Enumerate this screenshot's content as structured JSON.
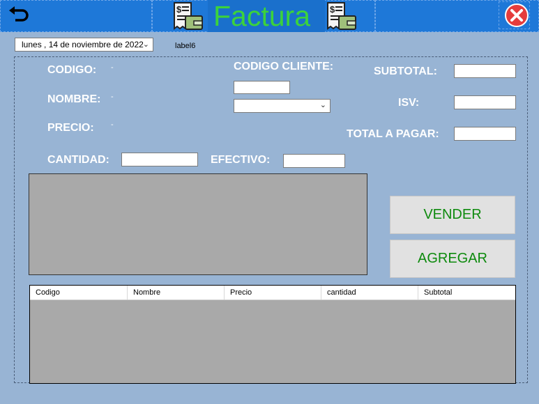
{
  "titlebar": {
    "title": "Factura",
    "back_icon": "back-arrow-icon",
    "close_icon": "close-icon",
    "invoice_icon": "invoice-icon"
  },
  "date_picker": {
    "value": "lunes    , 14 de noviembre de 2022"
  },
  "small_label": "label6",
  "form": {
    "codigo_label": "CODIGO:",
    "codigo_value": "-",
    "nombre_label": "NOMBRE:",
    "nombre_value": "-",
    "precio_label": "PRECIO:",
    "precio_value": "-",
    "codigo_cliente_label": "CODIGO CLIENTE:",
    "cantidad_label": "CANTIDAD:",
    "efectivo_label": "EFECTIVO:",
    "subtotal_label": "SUBTOTAL:",
    "isv_label": "ISV:",
    "total_label": "TOTAL A PAGAR:"
  },
  "buttons": {
    "vender": "VENDER",
    "agregar": "AGREGAR"
  },
  "grid": {
    "columns": [
      "Codigo",
      "Nombre",
      "Precio",
      "cantidad",
      "Subtotal"
    ]
  },
  "colors": {
    "titlebar": "#1e78d8",
    "title_text": "#3cd23c",
    "button_text": "#0d8a0d"
  }
}
